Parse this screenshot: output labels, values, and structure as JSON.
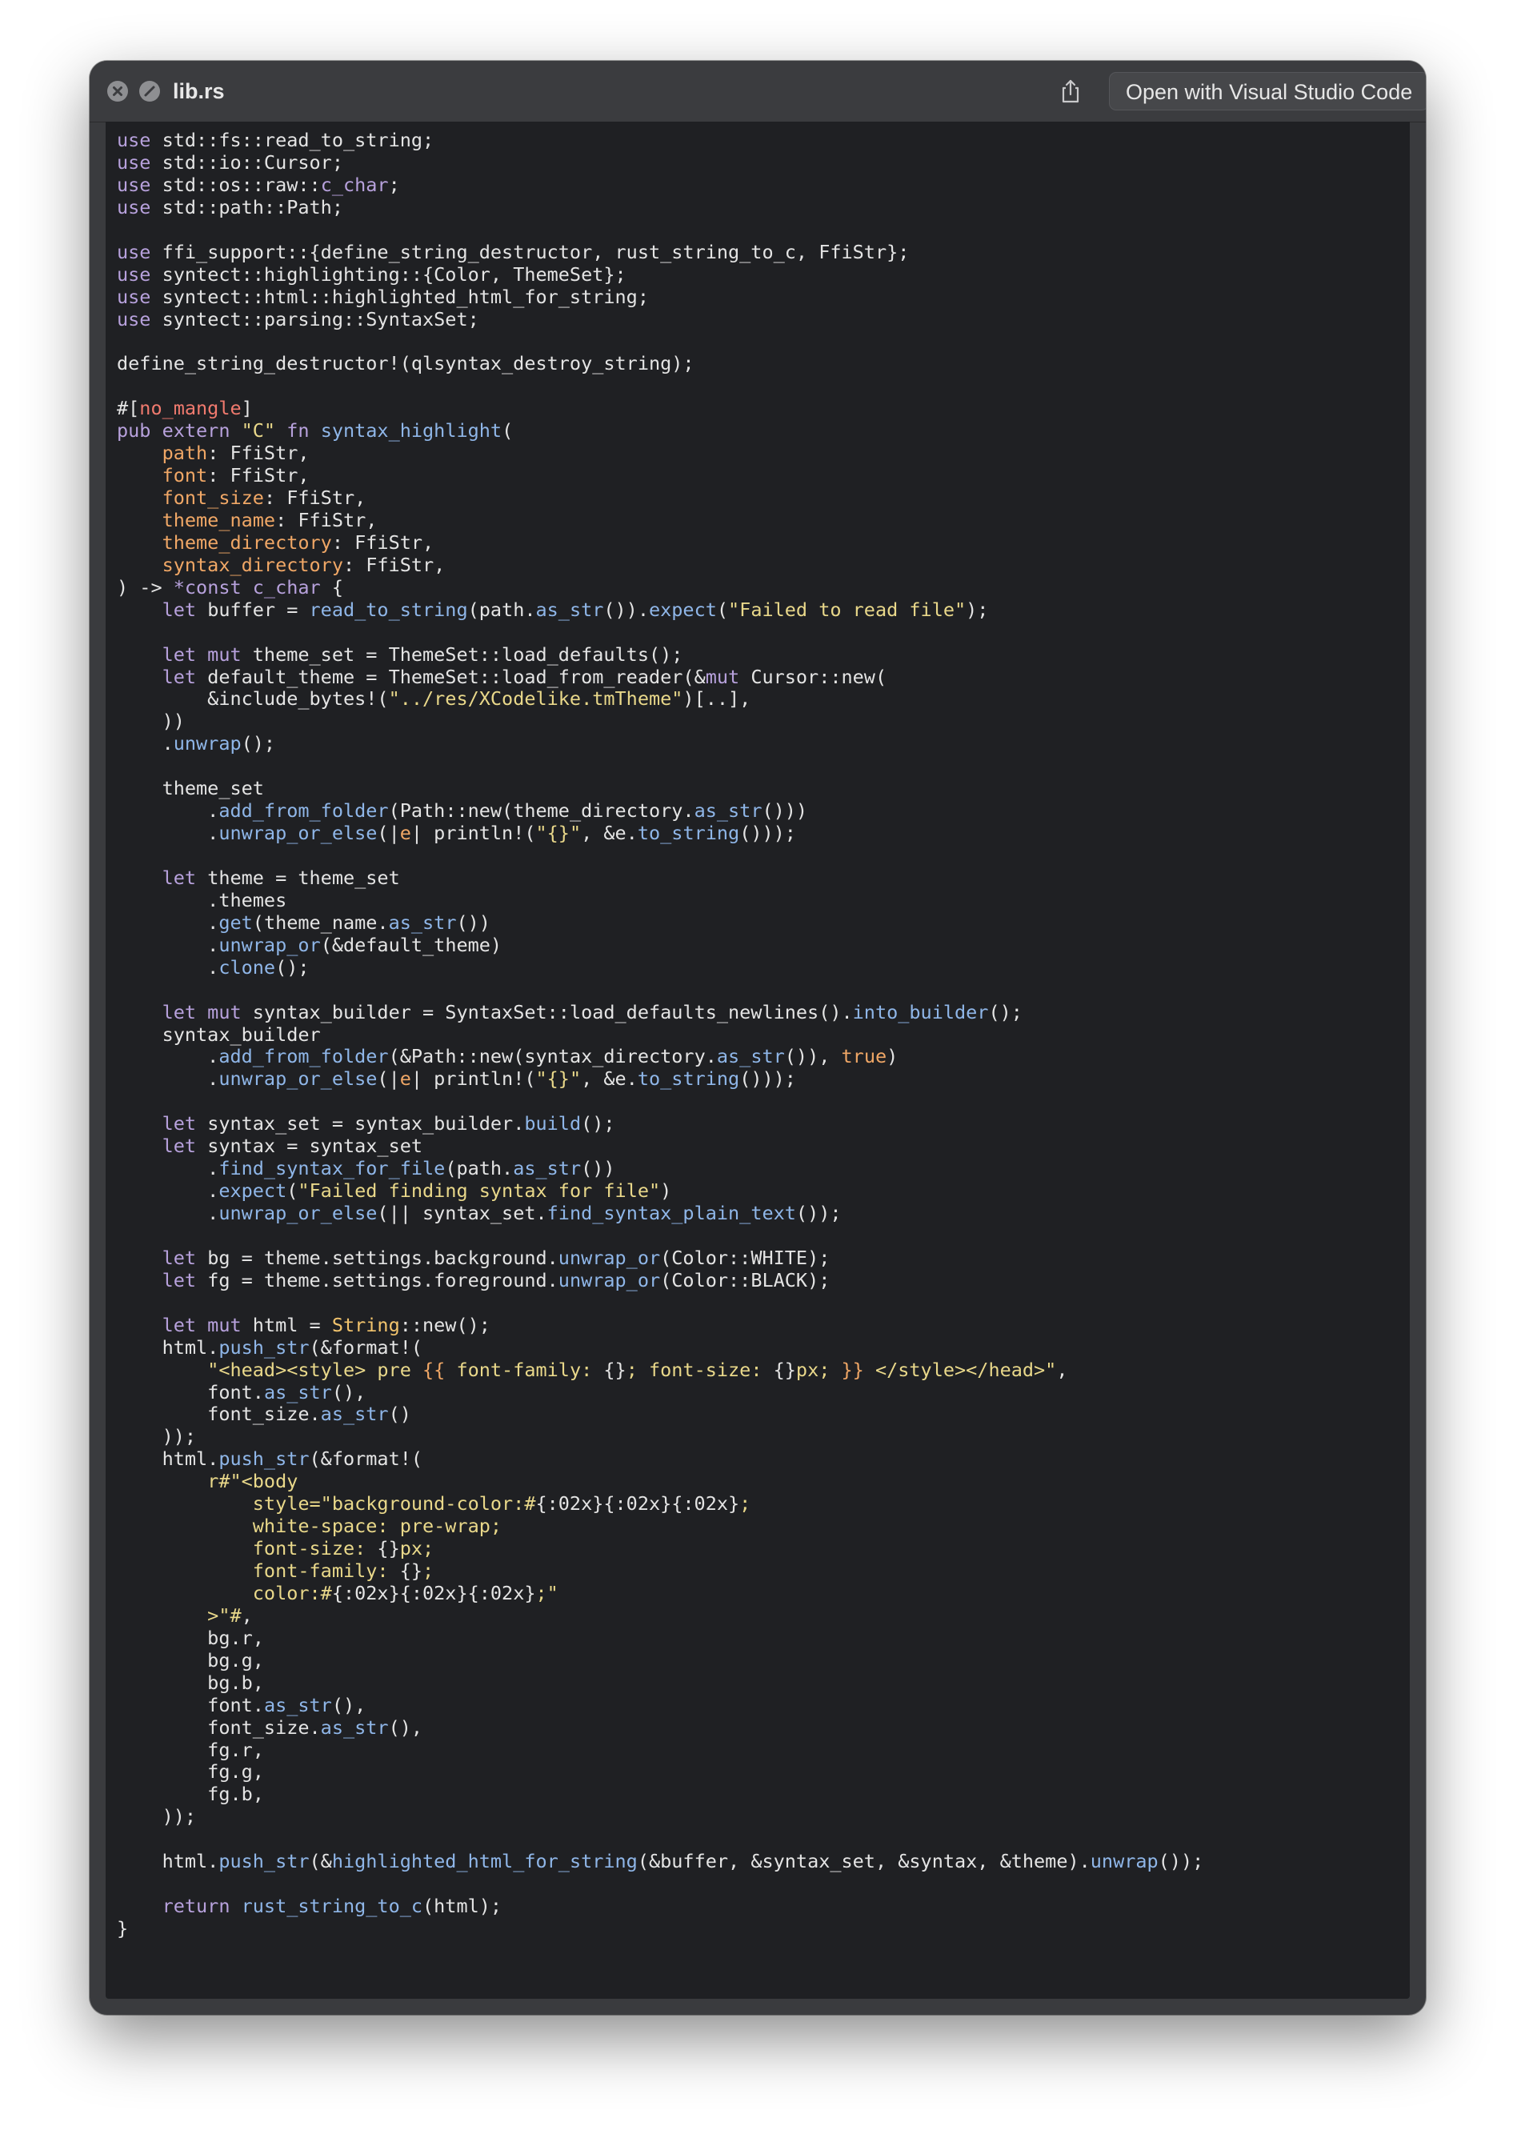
{
  "window": {
    "title": "lib.rs",
    "open_button_label": "Open with Visual Studio Code",
    "icons": {
      "close": "close-circle-icon",
      "hide": "hide-circle-icon",
      "share": "share-icon"
    }
  },
  "colors": {
    "keyword": "#b7a1dc",
    "function": "#8fb6e8",
    "string": "#e9d88a",
    "parameter": "#f0a766",
    "attribute": "#f07a6e",
    "background": "#1f2023"
  },
  "code_lines": [
    [
      [
        "kw",
        "use"
      ],
      [
        "pl",
        " std::fs::read_to_string;"
      ]
    ],
    [
      [
        "kw",
        "use"
      ],
      [
        "pl",
        " std::io::Cursor;"
      ]
    ],
    [
      [
        "kw",
        "use"
      ],
      [
        "pl",
        " std::os::raw::"
      ],
      [
        "kw",
        "c_char"
      ],
      [
        "pl",
        ";"
      ]
    ],
    [
      [
        "kw",
        "use"
      ],
      [
        "pl",
        " std::path::Path;"
      ]
    ],
    [],
    [
      [
        "kw",
        "use"
      ],
      [
        "pl",
        " ffi_support::{define_string_destructor, rust_string_to_c, FfiStr};"
      ]
    ],
    [
      [
        "kw",
        "use"
      ],
      [
        "pl",
        " syntect::highlighting::{Color, ThemeSet};"
      ]
    ],
    [
      [
        "kw",
        "use"
      ],
      [
        "pl",
        " syntect::html::highlighted_html_for_string;"
      ]
    ],
    [
      [
        "kw",
        "use"
      ],
      [
        "pl",
        " syntect::parsing::SyntaxSet;"
      ]
    ],
    [],
    [
      [
        "pl",
        "define_string_destructor!(qlsyntax_destroy_string);"
      ]
    ],
    [],
    [
      [
        "pl",
        "#["
      ],
      [
        "at",
        "no_mangle"
      ],
      [
        "pl",
        "]"
      ]
    ],
    [
      [
        "kw",
        "pub extern "
      ],
      [
        "st",
        "\"C\""
      ],
      [
        "kw",
        " fn "
      ],
      [
        "fn",
        "syntax_highlight"
      ],
      [
        "pl",
        "("
      ]
    ],
    [
      [
        "pl",
        "    "
      ],
      [
        "pa",
        "path"
      ],
      [
        "pl",
        ": FfiStr,"
      ]
    ],
    [
      [
        "pl",
        "    "
      ],
      [
        "pa",
        "font"
      ],
      [
        "pl",
        ": FfiStr,"
      ]
    ],
    [
      [
        "pl",
        "    "
      ],
      [
        "pa",
        "font_size"
      ],
      [
        "pl",
        ": FfiStr,"
      ]
    ],
    [
      [
        "pl",
        "    "
      ],
      [
        "pa",
        "theme_name"
      ],
      [
        "pl",
        ": FfiStr,"
      ]
    ],
    [
      [
        "pl",
        "    "
      ],
      [
        "pa",
        "theme_directory"
      ],
      [
        "pl",
        ": FfiStr,"
      ]
    ],
    [
      [
        "pl",
        "    "
      ],
      [
        "pa",
        "syntax_directory"
      ],
      [
        "pl",
        ": FfiStr,"
      ]
    ],
    [
      [
        "pl",
        ") -> "
      ],
      [
        "kw",
        "*const c_char"
      ],
      [
        "pl",
        " {"
      ]
    ],
    [
      [
        "pl",
        "    "
      ],
      [
        "kw",
        "let"
      ],
      [
        "pl",
        " buffer = "
      ],
      [
        "fn",
        "read_to_string"
      ],
      [
        "pl",
        "(path."
      ],
      [
        "fn",
        "as_str"
      ],
      [
        "pl",
        "())."
      ],
      [
        "fn",
        "expect"
      ],
      [
        "pl",
        "("
      ],
      [
        "st",
        "\"Failed to read file\""
      ],
      [
        "pl",
        ");"
      ]
    ],
    [],
    [
      [
        "pl",
        "    "
      ],
      [
        "kw",
        "let mut"
      ],
      [
        "pl",
        " theme_set = ThemeSet::load_defaults();"
      ]
    ],
    [
      [
        "pl",
        "    "
      ],
      [
        "kw",
        "let"
      ],
      [
        "pl",
        " default_theme = ThemeSet::load_from_reader(&"
      ],
      [
        "kw",
        "mut"
      ],
      [
        "pl",
        " Cursor::new("
      ]
    ],
    [
      [
        "pl",
        "        &include_bytes!("
      ],
      [
        "st",
        "\"../res/XCodelike.tmTheme\""
      ],
      [
        "pl",
        ")[..],"
      ]
    ],
    [
      [
        "pl",
        "    ))"
      ]
    ],
    [
      [
        "pl",
        "    ."
      ],
      [
        "fn",
        "unwrap"
      ],
      [
        "pl",
        "();"
      ]
    ],
    [],
    [
      [
        "pl",
        "    theme_set"
      ]
    ],
    [
      [
        "pl",
        "        ."
      ],
      [
        "fn",
        "add_from_folder"
      ],
      [
        "pl",
        "(Path::new(theme_directory."
      ],
      [
        "fn",
        "as_str"
      ],
      [
        "pl",
        "()))"
      ]
    ],
    [
      [
        "pl",
        "        ."
      ],
      [
        "fn",
        "unwrap_or_else"
      ],
      [
        "pl",
        "(|"
      ],
      [
        "pa",
        "e"
      ],
      [
        "pl",
        "| println!("
      ],
      [
        "st",
        "\"{}\""
      ],
      [
        "pl",
        ", &e."
      ],
      [
        "fn",
        "to_string"
      ],
      [
        "pl",
        "()));"
      ]
    ],
    [],
    [
      [
        "pl",
        "    "
      ],
      [
        "kw",
        "let"
      ],
      [
        "pl",
        " theme = theme_set"
      ]
    ],
    [
      [
        "pl",
        "        .themes"
      ]
    ],
    [
      [
        "pl",
        "        ."
      ],
      [
        "fn",
        "get"
      ],
      [
        "pl",
        "(theme_name."
      ],
      [
        "fn",
        "as_str"
      ],
      [
        "pl",
        "())"
      ]
    ],
    [
      [
        "pl",
        "        ."
      ],
      [
        "fn",
        "unwrap_or"
      ],
      [
        "pl",
        "(&default_theme)"
      ]
    ],
    [
      [
        "pl",
        "        ."
      ],
      [
        "fn",
        "clone"
      ],
      [
        "pl",
        "();"
      ]
    ],
    [],
    [
      [
        "pl",
        "    "
      ],
      [
        "kw",
        "let mut"
      ],
      [
        "pl",
        " syntax_builder = SyntaxSet::load_defaults_newlines()."
      ],
      [
        "fn",
        "into_builder"
      ],
      [
        "pl",
        "();"
      ]
    ],
    [
      [
        "pl",
        "    syntax_builder"
      ]
    ],
    [
      [
        "pl",
        "        ."
      ],
      [
        "fn",
        "add_from_folder"
      ],
      [
        "pl",
        "(&Path::new(syntax_directory."
      ],
      [
        "fn",
        "as_str"
      ],
      [
        "pl",
        "()), "
      ],
      [
        "bo",
        "true"
      ],
      [
        "pl",
        ")"
      ]
    ],
    [
      [
        "pl",
        "        ."
      ],
      [
        "fn",
        "unwrap_or_else"
      ],
      [
        "pl",
        "(|"
      ],
      [
        "pa",
        "e"
      ],
      [
        "pl",
        "| println!("
      ],
      [
        "st",
        "\"{}\""
      ],
      [
        "pl",
        ", &e."
      ],
      [
        "fn",
        "to_string"
      ],
      [
        "pl",
        "()));"
      ]
    ],
    [],
    [
      [
        "pl",
        "    "
      ],
      [
        "kw",
        "let"
      ],
      [
        "pl",
        " syntax_set = syntax_builder."
      ],
      [
        "fn",
        "build"
      ],
      [
        "pl",
        "();"
      ]
    ],
    [
      [
        "pl",
        "    "
      ],
      [
        "kw",
        "let"
      ],
      [
        "pl",
        " syntax = syntax_set"
      ]
    ],
    [
      [
        "pl",
        "        ."
      ],
      [
        "fn",
        "find_syntax_for_file"
      ],
      [
        "pl",
        "(path."
      ],
      [
        "fn",
        "as_str"
      ],
      [
        "pl",
        "())"
      ]
    ],
    [
      [
        "pl",
        "        ."
      ],
      [
        "fn",
        "expect"
      ],
      [
        "pl",
        "("
      ],
      [
        "st",
        "\"Failed finding syntax for file\""
      ],
      [
        "pl",
        ")"
      ]
    ],
    [
      [
        "pl",
        "        ."
      ],
      [
        "fn",
        "unwrap_or_else"
      ],
      [
        "pl",
        "(|| syntax_set."
      ],
      [
        "fn",
        "find_syntax_plain_text"
      ],
      [
        "pl",
        "());"
      ]
    ],
    [],
    [
      [
        "pl",
        "    "
      ],
      [
        "kw",
        "let"
      ],
      [
        "pl",
        " bg = theme.settings.background."
      ],
      [
        "fn",
        "unwrap_or"
      ],
      [
        "pl",
        "(Color::WHITE);"
      ]
    ],
    [
      [
        "pl",
        "    "
      ],
      [
        "kw",
        "let"
      ],
      [
        "pl",
        " fg = theme.settings.foreground."
      ],
      [
        "fn",
        "unwrap_or"
      ],
      [
        "pl",
        "(Color::BLACK);"
      ]
    ],
    [],
    [
      [
        "pl",
        "    "
      ],
      [
        "kw",
        "let mut"
      ],
      [
        "pl",
        " html = "
      ],
      [
        "ty",
        "String"
      ],
      [
        "pl",
        "::new();"
      ]
    ],
    [
      [
        "pl",
        "    html."
      ],
      [
        "fn",
        "push_str"
      ],
      [
        "pl",
        "(&format!("
      ]
    ],
    [
      [
        "pl",
        "        "
      ],
      [
        "st",
        "\"<head><style> pre "
      ],
      [
        "pa",
        "{{"
      ],
      [
        "st",
        " font-family: "
      ],
      [
        "pl",
        "{}"
      ],
      [
        "st",
        "; font-size: "
      ],
      [
        "pl",
        "{}"
      ],
      [
        "st",
        "px; "
      ],
      [
        "pa",
        "}}"
      ],
      [
        "st",
        " </style></head>\""
      ],
      [
        "pl",
        ","
      ]
    ],
    [
      [
        "pl",
        "        font."
      ],
      [
        "fn",
        "as_str"
      ],
      [
        "pl",
        "(),"
      ]
    ],
    [
      [
        "pl",
        "        font_size."
      ],
      [
        "fn",
        "as_str"
      ],
      [
        "pl",
        "()"
      ]
    ],
    [
      [
        "pl",
        "    ));"
      ]
    ],
    [
      [
        "pl",
        "    html."
      ],
      [
        "fn",
        "push_str"
      ],
      [
        "pl",
        "(&format!("
      ]
    ],
    [
      [
        "pl",
        "        "
      ],
      [
        "st",
        "r#\"<body"
      ]
    ],
    [
      [
        "st",
        "            style=\"background-color:#"
      ],
      [
        "pl",
        "{:02x}{:02x}{:02x}"
      ],
      [
        "st",
        ";"
      ]
    ],
    [
      [
        "st",
        "            white-space: pre-wrap;"
      ]
    ],
    [
      [
        "st",
        "            font-size: "
      ],
      [
        "pl",
        "{}"
      ],
      [
        "st",
        "px;"
      ]
    ],
    [
      [
        "st",
        "            font-family: "
      ],
      [
        "pl",
        "{}"
      ],
      [
        "st",
        ";"
      ]
    ],
    [
      [
        "st",
        "            color:#"
      ],
      [
        "pl",
        "{:02x}{:02x}{:02x}"
      ],
      [
        "st",
        ";\""
      ]
    ],
    [
      [
        "st",
        "        >\"#"
      ],
      [
        "pl",
        ","
      ]
    ],
    [
      [
        "pl",
        "        bg.r,"
      ]
    ],
    [
      [
        "pl",
        "        bg.g,"
      ]
    ],
    [
      [
        "pl",
        "        bg.b,"
      ]
    ],
    [
      [
        "pl",
        "        font."
      ],
      [
        "fn",
        "as_str"
      ],
      [
        "pl",
        "(),"
      ]
    ],
    [
      [
        "pl",
        "        font_size."
      ],
      [
        "fn",
        "as_str"
      ],
      [
        "pl",
        "(),"
      ]
    ],
    [
      [
        "pl",
        "        fg.r,"
      ]
    ],
    [
      [
        "pl",
        "        fg.g,"
      ]
    ],
    [
      [
        "pl",
        "        fg.b,"
      ]
    ],
    [
      [
        "pl",
        "    ));"
      ]
    ],
    [],
    [
      [
        "pl",
        "    html."
      ],
      [
        "fn",
        "push_str"
      ],
      [
        "pl",
        "(&"
      ],
      [
        "fn",
        "highlighted_html_for_string"
      ],
      [
        "pl",
        "(&buffer, &syntax_set, &syntax, &theme)."
      ],
      [
        "fn",
        "unwrap"
      ],
      [
        "pl",
        "());"
      ]
    ],
    [],
    [
      [
        "pl",
        "    "
      ],
      [
        "kw",
        "return"
      ],
      [
        "pl",
        " "
      ],
      [
        "fn",
        "rust_string_to_c"
      ],
      [
        "pl",
        "(html);"
      ]
    ],
    [
      [
        "pl",
        "}"
      ]
    ]
  ]
}
